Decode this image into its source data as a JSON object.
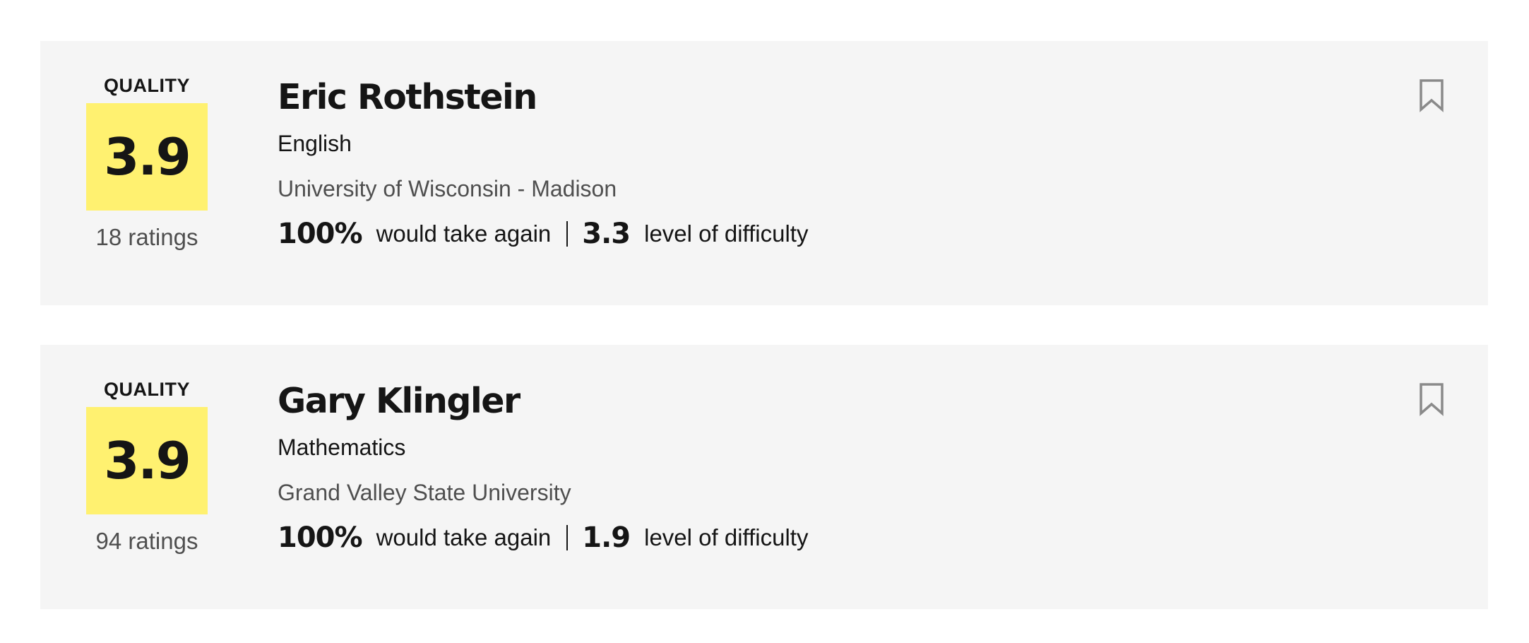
{
  "colors": {
    "card_background": "#f5f5f5",
    "quality_good": "#fff170",
    "text_primary": "#151515",
    "text_secondary": "#4f4f4f",
    "bookmark_stroke": "#8a8a8a"
  },
  "teachers": [
    {
      "quality_label": "QUALITY",
      "quality_score": "3.9",
      "num_ratings": "18 ratings",
      "name": "Eric Rothstein",
      "department": "English",
      "school": "University of Wisconsin - Madison",
      "would_take_again": "100%",
      "would_take_again_label": "would take again",
      "difficulty": "3.3",
      "difficulty_label": "level of difficulty",
      "bookmark_icon": "bookmark-outline-icon"
    },
    {
      "quality_label": "QUALITY",
      "quality_score": "3.9",
      "num_ratings": "94 ratings",
      "name": "Gary Klingler",
      "department": "Mathematics",
      "school": "Grand Valley State University",
      "would_take_again": "100%",
      "would_take_again_label": "would take again",
      "difficulty": "1.9",
      "difficulty_label": "level of difficulty",
      "bookmark_icon": "bookmark-outline-icon"
    }
  ]
}
